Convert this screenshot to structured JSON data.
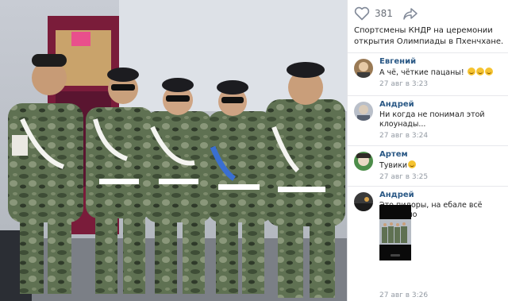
{
  "post": {
    "likes": "381",
    "caption": "Спортсмены КНДР на церемонии открытия Олимпиады в Пхенчхане."
  },
  "comments": [
    {
      "author": "Евгений",
      "text": "А чё, чёткие пацаны!",
      "emoji_count": 3,
      "date": "27 авг в 3:23"
    },
    {
      "author": "Андрей",
      "text": "Ни когда не понимал этой клоунады...",
      "date": "27 авг в 3:24"
    },
    {
      "author": "Артем",
      "text": "Тувики",
      "emoji_count": 1,
      "date": "27 авг в 3:25"
    },
    {
      "author": "Андрей",
      "text": "Это пидоры, на ебале всё написано",
      "date": "27 авг в 3:26",
      "has_image": true
    }
  ],
  "colors": {
    "link": "#2a5885",
    "muted": "#939aa3",
    "text": "#222222"
  },
  "icons": {
    "like": "heart-icon",
    "share": "share-arrow-icon",
    "emoji": "smiley-face-icon"
  }
}
